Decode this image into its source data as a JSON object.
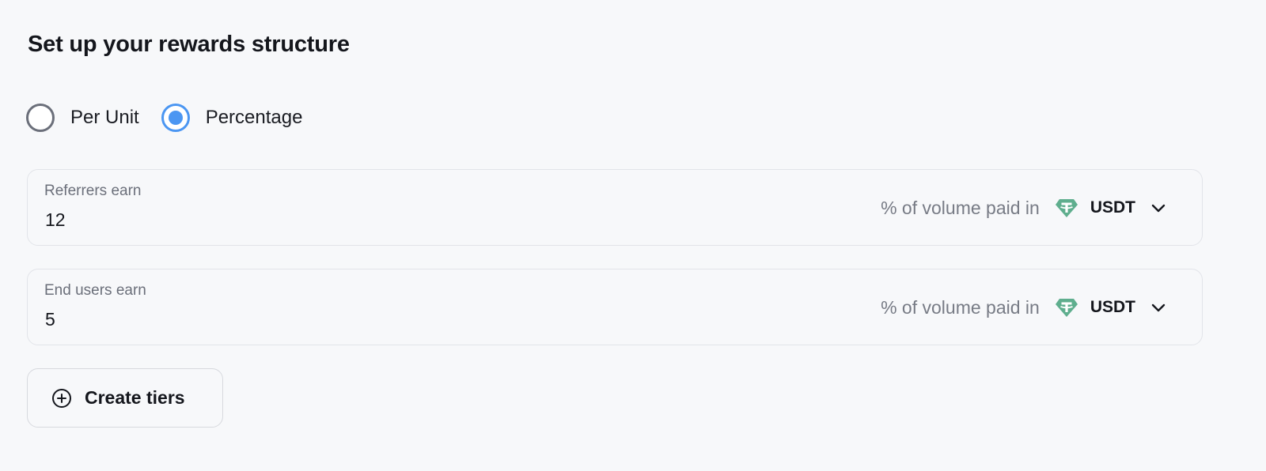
{
  "header": {
    "title": "Set up your rewards structure"
  },
  "reward_type": {
    "options": [
      {
        "label": "Per Unit",
        "selected": false
      },
      {
        "label": "Percentage",
        "selected": true
      }
    ]
  },
  "fields": [
    {
      "label": "Referrers earn",
      "value": "12",
      "suffix": "% of volume paid in",
      "currency": "USDT",
      "currency_icon": "tether-icon"
    },
    {
      "label": "End users earn",
      "value": "5",
      "suffix": "% of volume paid in",
      "currency": "USDT",
      "currency_icon": "tether-icon"
    }
  ],
  "actions": {
    "create_tiers_label": "Create tiers"
  },
  "colors": {
    "accent": "#4b96f2",
    "tether": "#5fae8e",
    "background": "#f7f8fa"
  }
}
